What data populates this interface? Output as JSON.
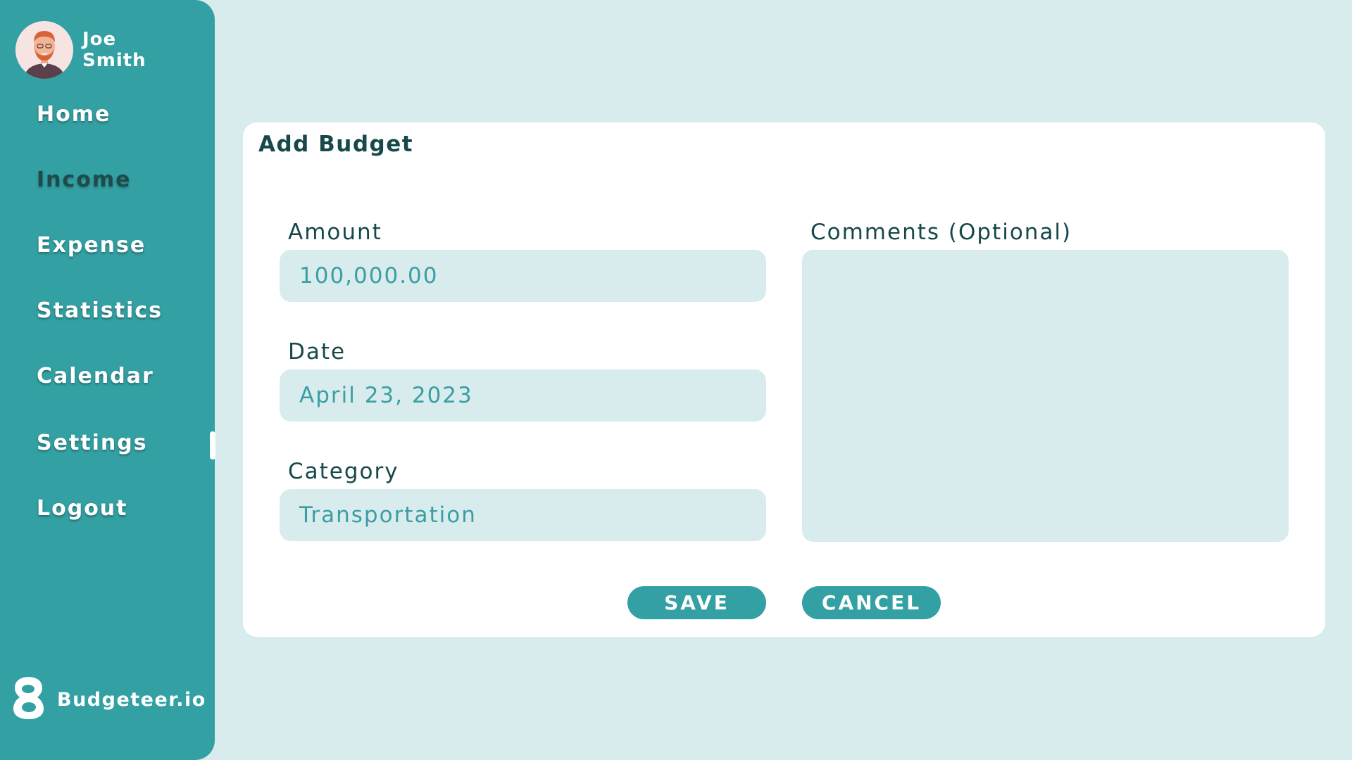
{
  "user": {
    "first_name": "Joe",
    "last_name": "Smith"
  },
  "sidebar": {
    "items": [
      {
        "label": "Home"
      },
      {
        "label": "Income"
      },
      {
        "label": "Expense"
      },
      {
        "label": "Statistics"
      },
      {
        "label": "Calendar"
      },
      {
        "label": "Settings"
      },
      {
        "label": "Logout"
      }
    ],
    "active_item": "Income"
  },
  "brand": {
    "name": "Budgeteer.io"
  },
  "form": {
    "title": "Add Budget",
    "amount": {
      "label": "Amount",
      "value": "100,000.00"
    },
    "date": {
      "label": "Date",
      "value": "April 23, 2023"
    },
    "category": {
      "label": "Category",
      "value": "Transportation"
    },
    "comments": {
      "label": "Comments (Optional)",
      "value": ""
    },
    "save_label": "SAVE",
    "cancel_label": "CANCEL"
  },
  "colors": {
    "sidebar": "#33a0a3",
    "background": "#d8ecee",
    "card": "#ffffff",
    "heading_text": "#17484a",
    "input_text": "#3a9ea2"
  }
}
